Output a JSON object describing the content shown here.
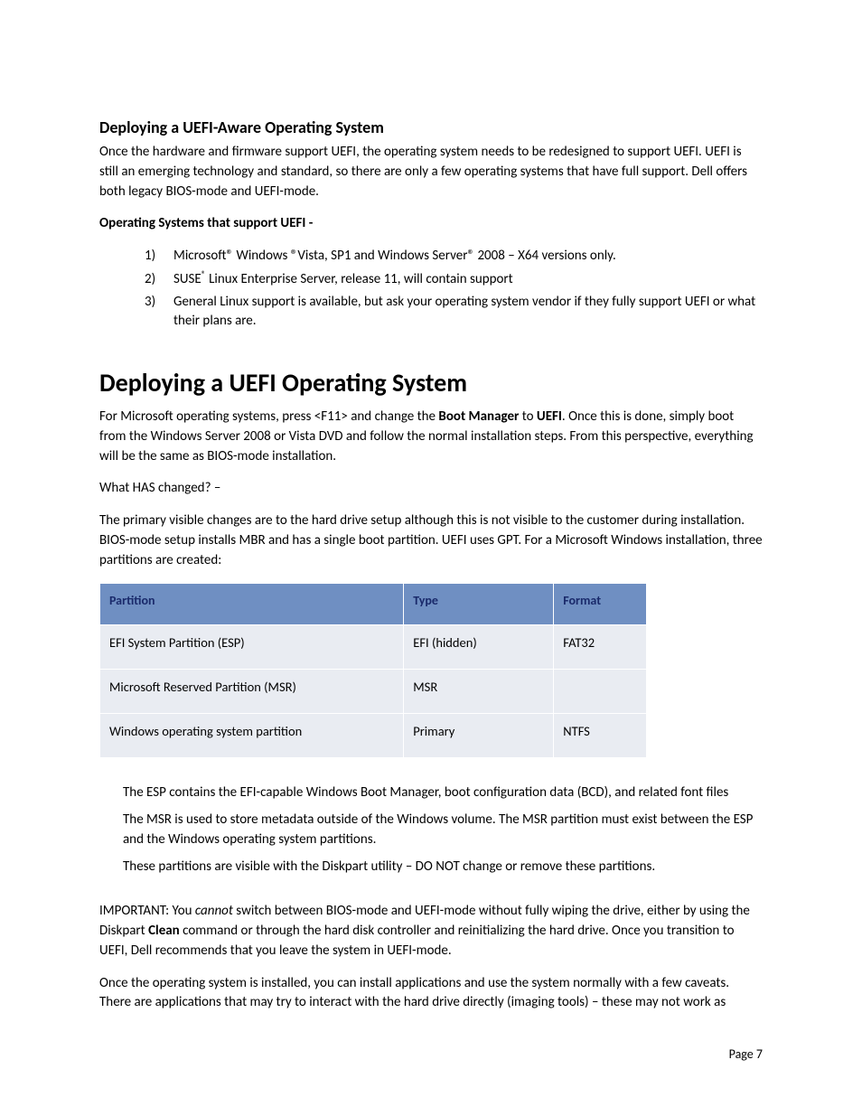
{
  "section1": {
    "heading": "Deploying a UEFI-Aware Operating System",
    "intro": "Once the hardware and firmware support UEFI, the operating system needs to be redesigned to support UEFI. UEFI is still an emerging technology and standard, so there are only a few operating systems that have full support. Dell offers both legacy BIOS-mode and UEFI-mode.",
    "subhead": "Operating Systems that support UEFI -",
    "list_item1": "Microsoft® Windows ®Vista, SP1 and Windows Server® 2008 – X64 versions only.",
    "list_item2_pre": "SUSE",
    "list_item2_post": " Linux Enterprise Server, release 11, will contain support",
    "list_item3": "General Linux support is available, but ask your operating system vendor if they fully support UEFI or what their plans are."
  },
  "section2": {
    "heading": "Deploying a UEFI Operating System",
    "intro_pre": "For Microsoft operating systems, press <F11> and change the ",
    "intro_b1": "Boot Manager",
    "intro_mid": " to ",
    "intro_b2": "UEFI",
    "intro_post": ". Once this is done, simply boot from the Windows Server 2008 or Vista DVD and follow the normal installation steps.  From this perspective, everything will be the same as BIOS-mode installation.",
    "q": "What HAS changed? –",
    "changes": "The primary visible changes are to the hard drive setup although this is not visible to the customer during installation.  BIOS-mode setup installs MBR and has a single boot partition.  UEFI uses GPT.  For a Microsoft Windows installation, three partitions are created:",
    "table": {
      "h1": "Partition",
      "h2": "Type",
      "h3": "Format",
      "r1c1": "EFI System Partition (ESP)",
      "r1c2": "EFI (hidden)",
      "r1c3": "FAT32",
      "r2c1": "Microsoft Reserved Partition (MSR)",
      "r2c2": "MSR",
      "r2c3": "",
      "r3c1": "Windows operating system partition",
      "r3c2": "Primary",
      "r3c3": "NTFS"
    },
    "note1": "The ESP contains the EFI-capable Windows Boot Manager, boot configuration data (BCD), and related font files",
    "note2": "The MSR is used to store metadata outside of the Windows volume. The MSR partition must exist between the ESP and the Windows operating system partitions.",
    "note3": "These partitions are visible with the Diskpart utility – DO NOT change or remove these partitions.",
    "important_pre": "IMPORTANT:  You ",
    "important_em": "cannot",
    "important_mid": " switch between BIOS-mode and UEFI-mode without fully wiping the drive, either by using the Diskpart ",
    "important_b": "Clean",
    "important_post": " command or through the hard disk controller and reinitializing the hard drive.  Once you transition to UEFI, Dell recommends that you leave the system in UEFI-mode.",
    "closing": "Once the operating system is installed, you can install applications and use the system normally with a few caveats. There are applications that may try to interact with the hard drive directly (imaging tools) – these may not work as"
  },
  "footer": "Page 7"
}
